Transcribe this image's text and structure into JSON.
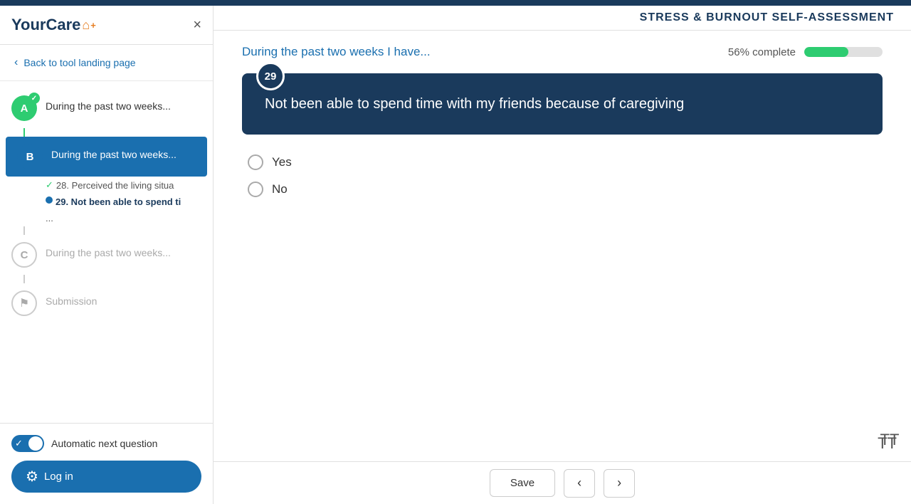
{
  "app": {
    "logo": "YourCare",
    "logo_icon": "⌂",
    "close_label": "×"
  },
  "header": {
    "assessment_title": "STRESS & BURNOUT SELF-ASSESSMENT"
  },
  "back_link": {
    "label": "Back to tool landing page"
  },
  "sidebar": {
    "sections": [
      {
        "id": "A",
        "status": "completed",
        "label": "During the past two weeks...",
        "connector_color": "green"
      },
      {
        "id": "B",
        "status": "active",
        "label": "During the past two weeks...",
        "sub_items": [
          {
            "text": "28. Perceived the living situa",
            "done": true
          },
          {
            "text": "29. Not been able to spend ti",
            "done": false,
            "current": true
          },
          {
            "text": "...",
            "done": false
          }
        ]
      },
      {
        "id": "C",
        "status": "inactive",
        "label": "During the past two weeks..."
      },
      {
        "id": "flag",
        "status": "flag",
        "label": "Submission"
      }
    ]
  },
  "question": {
    "context": "During the past two weeks I have...",
    "number": "29",
    "text": "Not been able to spend time with my friends because of caregiving",
    "options": [
      {
        "id": "yes",
        "label": "Yes"
      },
      {
        "id": "no",
        "label": "No"
      }
    ]
  },
  "progress": {
    "percent": "56%",
    "label": "complete",
    "bar_width": "56"
  },
  "footer": {
    "toggle_label": "Automatic next question",
    "login_label": "Log in"
  },
  "bottom_bar": {
    "save_label": "Save",
    "prev_icon": "‹",
    "next_icon": "›"
  },
  "font_resize_icon": "TT"
}
